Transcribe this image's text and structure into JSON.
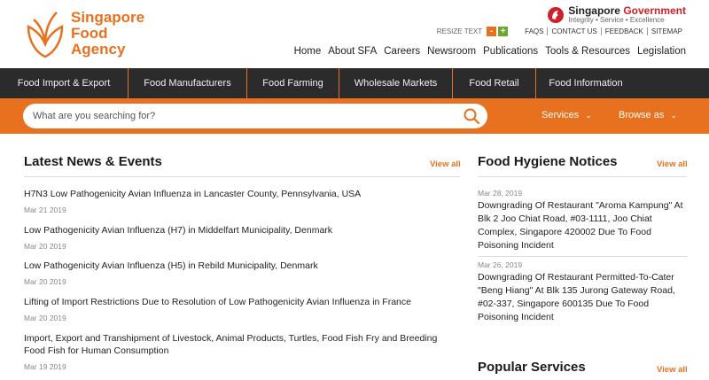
{
  "header": {
    "logo_lines": [
      "Singapore",
      "Food",
      "Agency"
    ],
    "gov_title_main": "Singapore ",
    "gov_title_red": "Government",
    "gov_subtitle": "Integrity • Service • Excellence",
    "resize_text": "RESIZE TEXT",
    "resize_minus": "-",
    "resize_plus": "+",
    "utility_links": [
      "FAQS",
      "CONTACT US",
      "FEEDBACK",
      "SITEMAP"
    ],
    "main_nav": [
      "Home",
      "About SFA",
      "Careers",
      "Newsroom",
      "Publications",
      "Tools & Resources",
      "Legislation"
    ]
  },
  "categories": [
    "Food Import & Export",
    "Food Manufacturers",
    "Food Farming",
    "Wholesale Markets",
    "Food Retail",
    "Food Information"
  ],
  "search": {
    "placeholder": "What are you searching for?",
    "services_label": "Services",
    "browse_label": "Browse as"
  },
  "news": {
    "title": "Latest News & Events",
    "view_all": "View all",
    "items": [
      {
        "title": "H7N3 Low Pathogenicity Avian Influenza in Lancaster County, Pennsylvania, USA",
        "date": "Mar 21 2019"
      },
      {
        "title": "Low Pathogenicity Avian Influenza (H7) in Middelfart Municipality, Denmark",
        "date": "Mar 20 2019"
      },
      {
        "title": "Low Pathogenicity Avian Influenza (H5) in Rebild Municipality, Denmark",
        "date": "Mar 20 2019"
      },
      {
        "title": "Lifting of Import Restrictions Due to Resolution of Low Pathogenicity Avian Influenza in France",
        "date": "Mar 20 2019"
      },
      {
        "title": "Import, Export and Transhipment of Livestock, Animal Products, Turtles, Food Fish Fry and Breeding Food Fish for Human Consumption",
        "date": "Mar 19 2019"
      }
    ]
  },
  "hygiene": {
    "title": "Food Hygiene Notices",
    "view_all": "View all",
    "items": [
      {
        "date": "Mar 28, 2019",
        "title": "Downgrading Of Restaurant \"Aroma Kampung\" At Blk 2 Joo Chiat Road, #03-1111, Joo Chiat Complex, Singapore 420002 Due To Food Poisoning Incident"
      },
      {
        "date": "Mar 26, 2019",
        "title": "Downgrading Of Restaurant Permitted-To-Cater \"Beng Hiang\" At Blk 135 Jurong Gateway Road, #02-337, Singapore 600135 Due To Food Poisoning Incident"
      }
    ]
  },
  "popular": {
    "title": "Popular Services",
    "view_all": "View all"
  },
  "colors": {
    "brand_orange": "#e8711f",
    "nav_dark": "#2b2b2b",
    "gov_red": "#d0202a"
  }
}
